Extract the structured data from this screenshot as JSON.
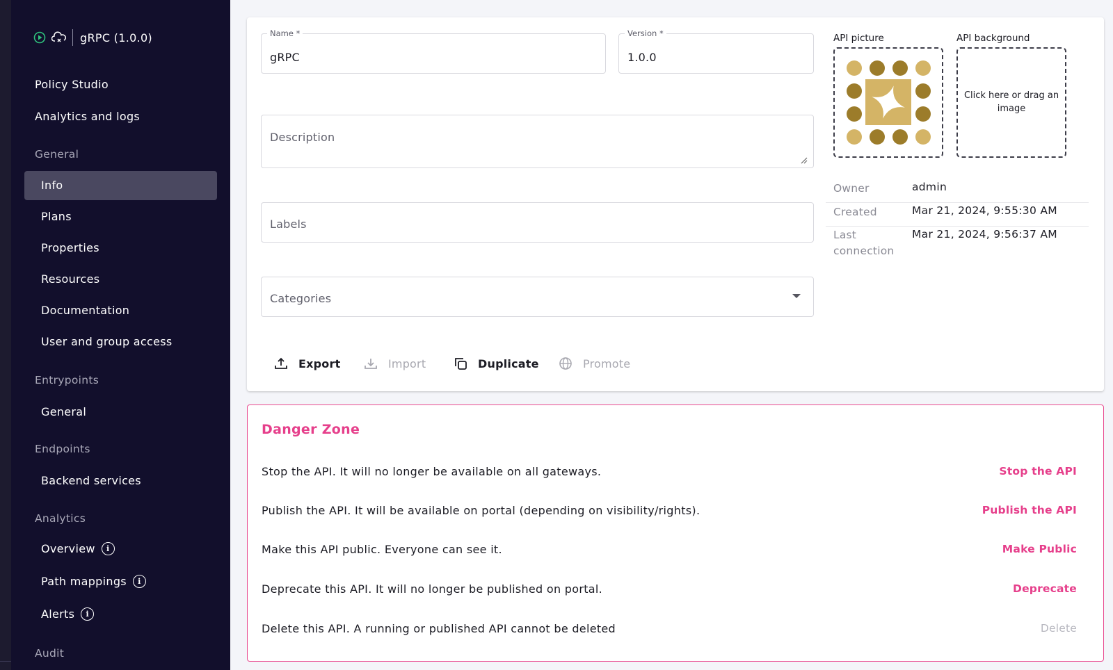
{
  "sidebar": {
    "api_title": "gRPC (1.0.0)",
    "top_links": [
      "Policy Studio",
      "Analytics and logs"
    ],
    "sections": {
      "general": {
        "title": "General",
        "items": [
          "Info",
          "Plans",
          "Properties",
          "Resources",
          "Documentation",
          "User and group access"
        ]
      },
      "entrypoints": {
        "title": "Entrypoints",
        "items": [
          "General"
        ]
      },
      "endpoints": {
        "title": "Endpoints",
        "items": [
          "Backend services"
        ]
      },
      "analytics": {
        "title": "Analytics",
        "items": [
          "Overview",
          "Path mappings",
          "Alerts"
        ]
      },
      "audit": {
        "title": "Audit"
      }
    },
    "active_item": "Info"
  },
  "form": {
    "name": {
      "label": "Name *",
      "value": "gRPC"
    },
    "version": {
      "label": "Version *",
      "value": "1.0.0"
    },
    "description": {
      "placeholder": "Description"
    },
    "labels": {
      "placeholder": "Labels"
    },
    "categories": {
      "placeholder": "Categories"
    }
  },
  "images": {
    "picture_label": "API picture",
    "background_label": "API background",
    "background_hint": "Click here or drag an image"
  },
  "meta": {
    "owner_label": "Owner",
    "owner_value": "admin",
    "created_label": "Created",
    "created_value": "Mar 21, 2024, 9:55:30 AM",
    "last_connection_label": "Last connection",
    "last_connection_value": "Mar 21, 2024, 9:56:37 AM"
  },
  "actions": {
    "export": "Export",
    "import": "Import",
    "duplicate": "Duplicate",
    "promote": "Promote"
  },
  "danger_zone": {
    "title": "Danger Zone",
    "rows": [
      {
        "text": "Stop the API. It will no longer be available on all gateways.",
        "button": "Stop the API"
      },
      {
        "text": "Publish the API. It will be available on portal (depending on visibility/rights).",
        "button": "Publish the API"
      },
      {
        "text": "Make this API public. Everyone can see it.",
        "button": "Make Public"
      },
      {
        "text": "Deprecate this API. It will no longer be published on portal.",
        "button": "Deprecate"
      },
      {
        "text": "Delete this API. A running or published API cannot be deleted",
        "button": "Delete"
      }
    ]
  },
  "colors": {
    "sidebar_bg": "#120f2c",
    "active_bg": "#4a4860",
    "danger_accent": "#e63f8b",
    "avatar_light": "#d4b466",
    "avatar_dark": "#9c7c2a"
  }
}
